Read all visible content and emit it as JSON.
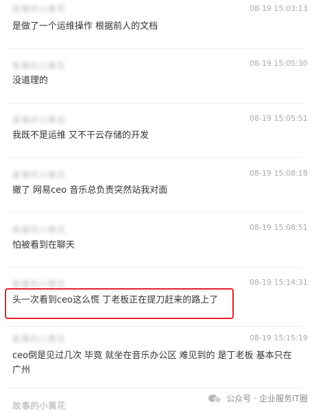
{
  "comments": [
    {
      "author": "故事的小黄花",
      "time": "08-19 15:03:13",
      "text": "是做了一个运维操作 根据前人的文档"
    },
    {
      "author": "故事的小黄花",
      "time": "08-19 15:05:30",
      "text": "没道理的"
    },
    {
      "author": "故事的小黄花",
      "time": "08-19 15:05:51",
      "text": "我既不是运维 又不干云存储的开发"
    },
    {
      "author": "故事的小黄花",
      "time": "08-19 15:08:18",
      "text": "撤了 网易ceo 音乐总负责突然站我对面"
    },
    {
      "author": "故事的小黄花",
      "time": "08-19 15:08:51",
      "text": "怕被看到在聊天"
    },
    {
      "author": "故事的小黄花",
      "time": "08-19 15:14:31",
      "text": "头一次看到ceo这么慌 丁老板正在提刀赶来的路上了"
    },
    {
      "author": "故事的小黄花",
      "time": "08-19 15:15:19",
      "text": "ceo倒是见过几次 毕竟 就坐在音乐办公区 难见到的 是丁老板 基本只在广州"
    }
  ],
  "footer_author": "故事的小黄花",
  "watermark": {
    "prefix": "公众号",
    "separator": "·",
    "name": "企业服务IT圈",
    "icon": "wechat-icon"
  },
  "highlight_color": "#e8202a"
}
